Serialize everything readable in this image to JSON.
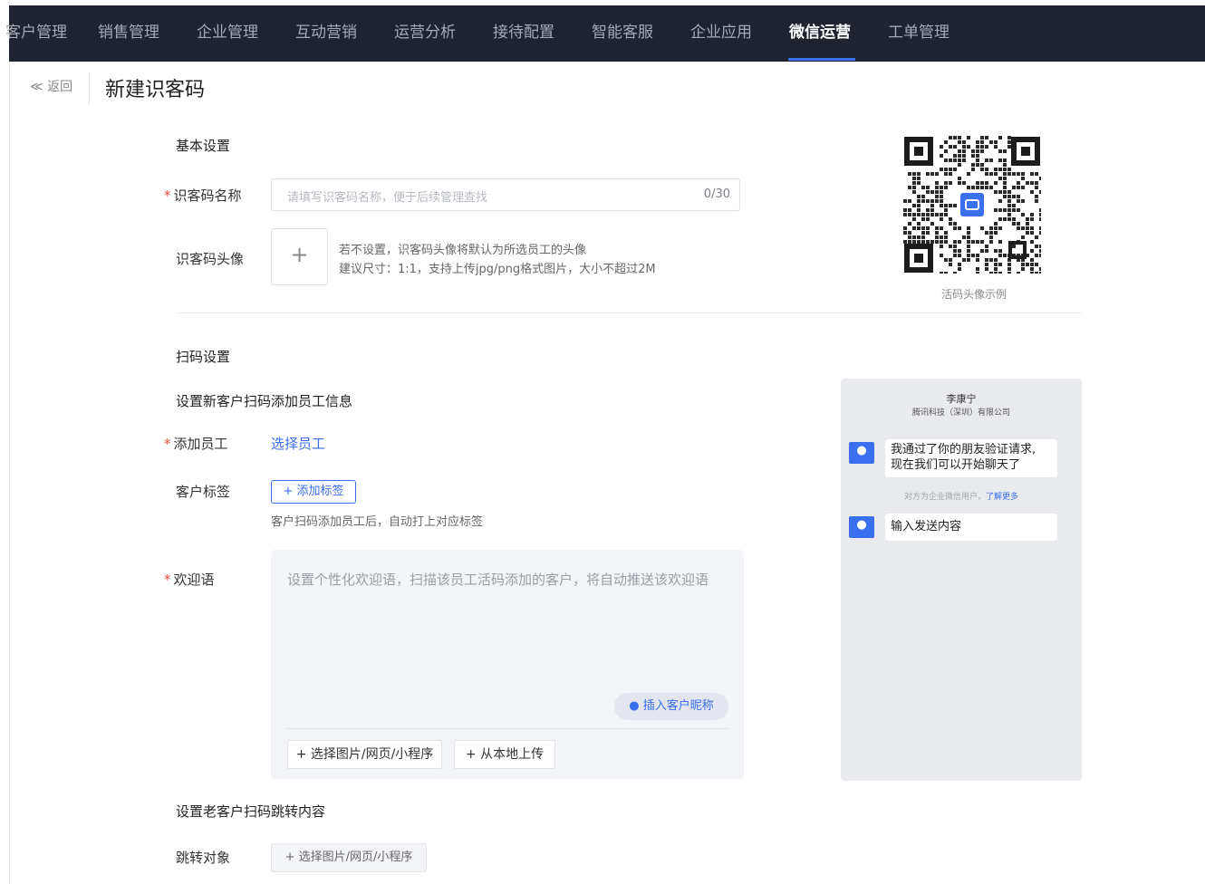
{
  "nav": {
    "items": [
      "客户管理",
      "销售管理",
      "企业管理",
      "互动营销",
      "运营分析",
      "接待配置",
      "智能客服",
      "企业应用",
      "微信运营",
      "工单管理"
    ],
    "active_index": 8
  },
  "header": {
    "back": "≪ 返回",
    "title": "新建识客码"
  },
  "basic": {
    "section_title": "基本设置",
    "name_label": "识客码名称",
    "name_placeholder": "请填写识客码名称，便于后续管理查找",
    "name_counter": "0/30",
    "avatar_label": "识客码头像",
    "avatar_hint1": "若不设置，识客码头像将默认为所选员工的头像",
    "avatar_hint2": "建议尺寸：1:1，支持上传jpg/png格式图片，大小不超过2M",
    "qr_caption": "活码头像示例"
  },
  "scan": {
    "section_title": "扫码设置",
    "new_customer_title": "设置新客户扫码添加员工信息",
    "add_staff_label": "添加员工",
    "add_staff_link": "选择员工",
    "tag_label": "客户标签",
    "tag_button": "+ 添加标签",
    "tag_hint": "客户扫码添加员工后，自动打上对应标签",
    "welcome_label": "欢迎语",
    "welcome_placeholder": "设置个性化欢迎语，扫描该员工活码添加的客户，将自动推送该欢迎语",
    "insert_nickname": "插入客户昵称",
    "select_media": "+ 选择图片/网页/小程序",
    "upload_local": "+ 从本地上传",
    "old_customer_title": "设置老客户扫码跳转内容",
    "jump_label": "跳转对象",
    "jump_button": "+ 选择图片/网页/小程序"
  },
  "preview": {
    "name": "李康宁",
    "company": "腾讯科技（深圳）有限公司",
    "msg1_line1": "我通过了你的朋友验证请求,",
    "msg1_line2": "现在我们可以开始聊天了",
    "notice": "对方为企业微信用户，",
    "notice_link": "了解更多",
    "msg2": "输入发送内容"
  },
  "colors": {
    "accent": "#3a6ff0",
    "nav_bg": "#1f2330",
    "required": "#e34d43"
  }
}
